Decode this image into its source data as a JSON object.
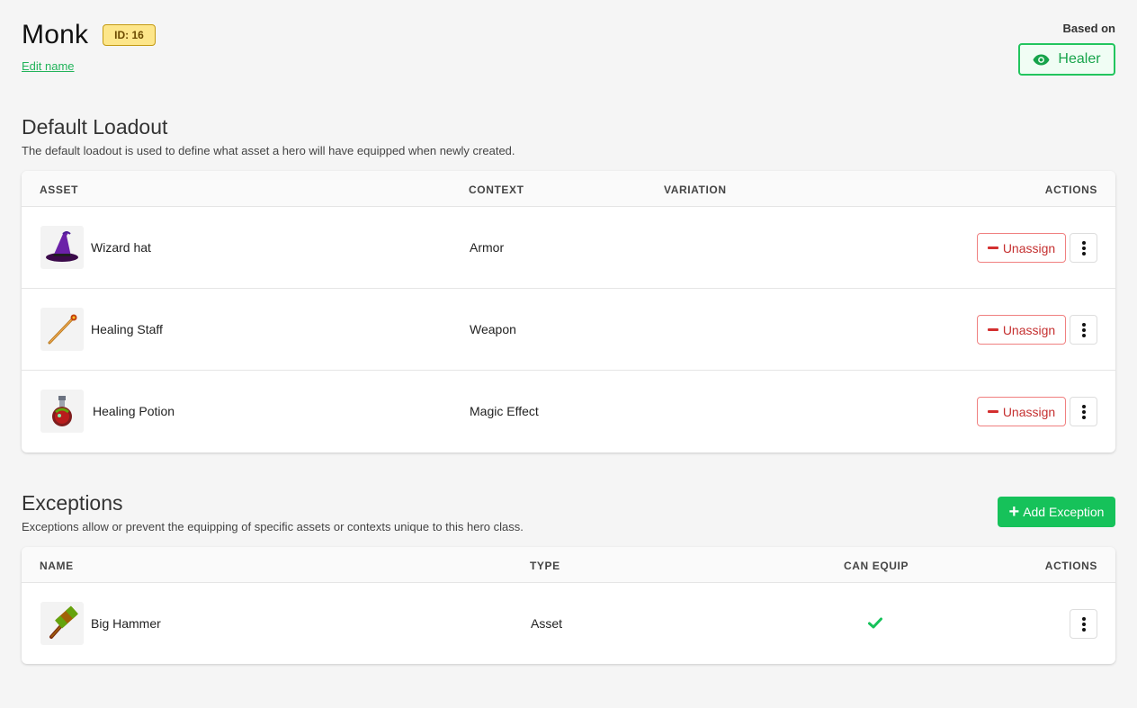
{
  "header": {
    "title": "Monk",
    "id_badge": "ID: 16",
    "edit_link": "Edit name",
    "based_on_label": "Based on",
    "based_on_button": "Healer"
  },
  "loadout": {
    "title": "Default Loadout",
    "description": "The default loadout is used to define what asset a hero will have equipped when newly created.",
    "columns": [
      "ASSET",
      "CONTEXT",
      "VARIATION",
      "ACTIONS"
    ],
    "rows": [
      {
        "asset": "Wizard hat",
        "context": "Armor",
        "variation": "",
        "action": "Unassign",
        "icon": "wizard-hat-icon"
      },
      {
        "asset": "Healing Staff",
        "context": "Weapon",
        "variation": "",
        "action": "Unassign",
        "icon": "staff-icon"
      },
      {
        "asset": "Healing Potion",
        "context": "Magic Effect",
        "variation": "",
        "action": "Unassign",
        "icon": "potion-icon"
      }
    ]
  },
  "exceptions": {
    "title": "Exceptions",
    "description": "Exceptions allow or prevent the equipping of specific assets or contexts unique to this hero class.",
    "add_button": "Add Exception",
    "columns": [
      "NAME",
      "TYPE",
      "CAN EQUIP",
      "ACTIONS"
    ],
    "rows": [
      {
        "name": "Big Hammer",
        "type": "Asset",
        "can_equip": true,
        "icon": "hammer-icon"
      }
    ]
  },
  "colors": {
    "accent": "#16c25a",
    "danger": "#c53030",
    "badge": "#fde68a"
  }
}
